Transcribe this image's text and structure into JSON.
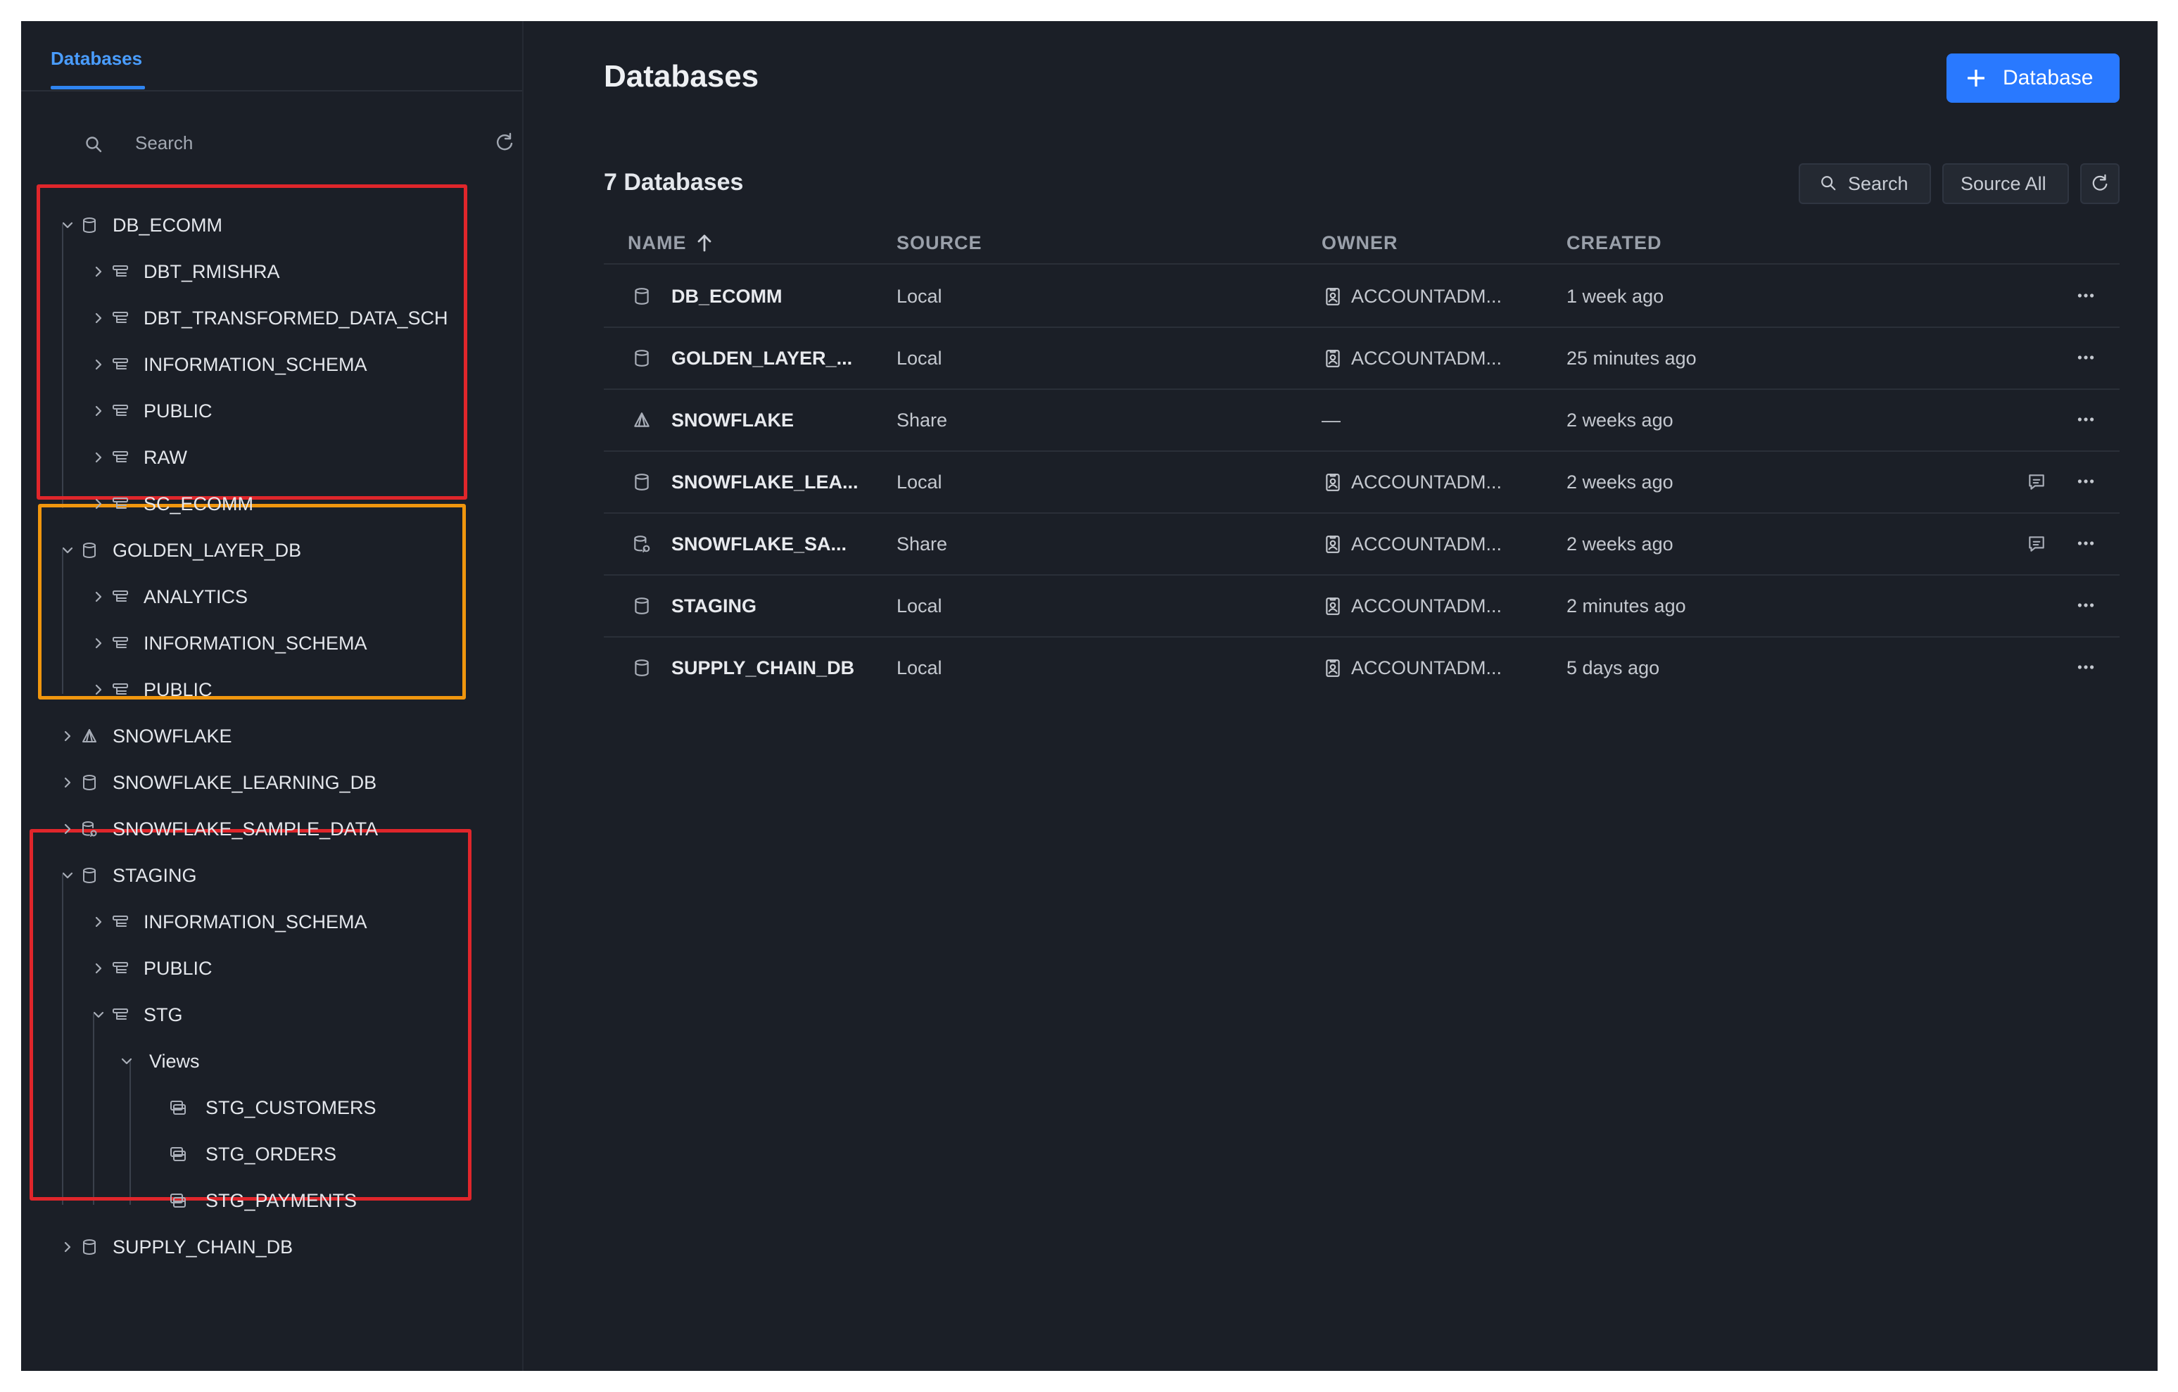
{
  "sidebar": {
    "tab": "Databases",
    "search_placeholder": "Search",
    "tree": [
      {
        "label": "DB_ECOMM",
        "expanded": true,
        "icon": "database-icon"
      },
      {
        "label": "DBT_RMISHRA",
        "icon": "schema-icon"
      },
      {
        "label": "DBT_TRANSFORMED_DATA_SCH",
        "icon": "schema-icon"
      },
      {
        "label": "INFORMATION_SCHEMA",
        "icon": "schema-icon"
      },
      {
        "label": "PUBLIC",
        "icon": "schema-icon"
      },
      {
        "label": "RAW",
        "icon": "schema-icon"
      },
      {
        "label": "SC_ECOMM",
        "icon": "schema-icon"
      },
      {
        "label": "GOLDEN_LAYER_DB",
        "expanded": true,
        "icon": "database-icon"
      },
      {
        "label": "ANALYTICS",
        "icon": "schema-icon"
      },
      {
        "label": "INFORMATION_SCHEMA",
        "icon": "schema-icon"
      },
      {
        "label": "PUBLIC",
        "icon": "schema-icon"
      },
      {
        "label": "SNOWFLAKE",
        "icon": "share-icon"
      },
      {
        "label": "SNOWFLAKE_LEARNING_DB",
        "icon": "database-icon"
      },
      {
        "label": "SNOWFLAKE_SAMPLE_DATA",
        "icon": "shared-database-icon"
      },
      {
        "label": "STAGING",
        "expanded": true,
        "icon": "database-icon"
      },
      {
        "label": "INFORMATION_SCHEMA",
        "icon": "schema-icon"
      },
      {
        "label": "PUBLIC",
        "icon": "schema-icon"
      },
      {
        "label": "STG",
        "expanded": true,
        "icon": "schema-icon"
      },
      {
        "label": "Views",
        "expanded": true,
        "icon": "folder"
      },
      {
        "label": "STG_CUSTOMERS",
        "icon": "view-icon"
      },
      {
        "label": "STG_ORDERS",
        "icon": "view-icon"
      },
      {
        "label": "STG_PAYMENTS",
        "icon": "view-icon"
      },
      {
        "label": "SUPPLY_CHAIN_DB",
        "icon": "database-icon"
      }
    ]
  },
  "main": {
    "title": "Databases",
    "primary_button": "Database",
    "count_label": "7 Databases",
    "toolbar": {
      "search": "Search",
      "source_filter": "Source All"
    },
    "table": {
      "columns": [
        "NAME",
        "SOURCE",
        "OWNER",
        "CREATED"
      ],
      "rows": [
        {
          "name": "DB_ECOMM",
          "source": "Local",
          "owner": "ACCOUNTADM...",
          "created": "1 week ago",
          "comment": false
        },
        {
          "name": "GOLDEN_LAYER_...",
          "source": "Local",
          "owner": "ACCOUNTADM...",
          "created": "25 minutes ago",
          "comment": false
        },
        {
          "name": "SNOWFLAKE",
          "source": "Share",
          "owner": "—",
          "created": "2 weeks ago",
          "comment": false
        },
        {
          "name": "SNOWFLAKE_LEA...",
          "source": "Local",
          "owner": "ACCOUNTADM...",
          "created": "2 weeks ago",
          "comment": true
        },
        {
          "name": "SNOWFLAKE_SA...",
          "source": "Share",
          "owner": "ACCOUNTADM...",
          "created": "2 weeks ago",
          "comment": true
        },
        {
          "name": "STAGING",
          "source": "Local",
          "owner": "ACCOUNTADM...",
          "created": "2 minutes ago",
          "comment": false
        },
        {
          "name": "SUPPLY_CHAIN_DB",
          "source": "Local",
          "owner": "ACCOUNTADM...",
          "created": "5 days ago",
          "comment": false
        }
      ]
    }
  },
  "colors": {
    "background": "#1b1f27",
    "accent": "#2979ff",
    "annotation_red": "#e0262b",
    "annotation_orange": "#f0960e"
  }
}
